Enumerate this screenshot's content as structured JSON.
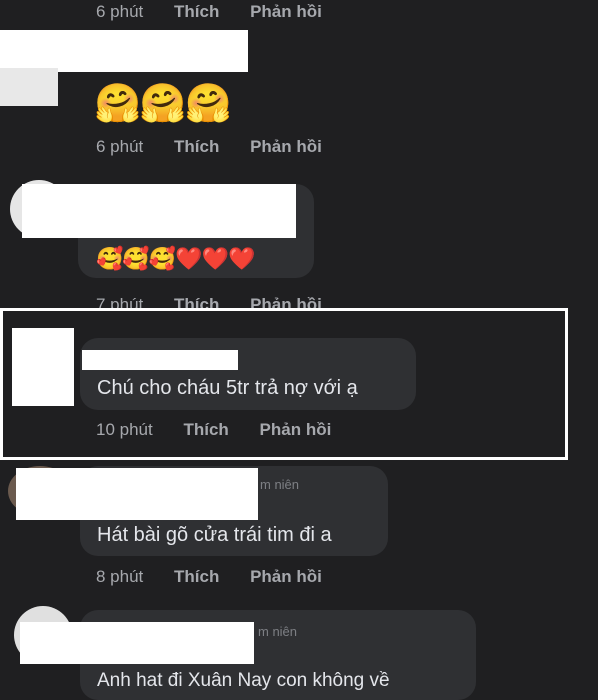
{
  "comments": [
    {
      "time": "6 phút",
      "like": "Thích",
      "reply": "Phản hồi"
    },
    {
      "emojis": "🤗🤗🤗",
      "time": "6 phút",
      "like": "Thích",
      "reply": "Phản hồi"
    },
    {
      "emojis": "🥰🥰🥰❤️❤️❤️",
      "time": "7 phút",
      "like": "Thích",
      "reply": "Phản hồi"
    },
    {
      "text": "Chú cho cháu 5tr trả nợ với ạ",
      "time": "10 phút",
      "like": "Thích",
      "reply": "Phản hồi"
    },
    {
      "badge": "m niên",
      "text": "Hát bài gõ cửa trái tim đi a",
      "time": "8 phút",
      "like": "Thích",
      "reply": "Phản hồi"
    },
    {
      "badge": "m niên",
      "text": "Anh hat đi Xuân Nay con không về"
    }
  ],
  "colors": {
    "background": "#1f1f21",
    "bubble": "#2f3033",
    "meta": "#a6a8ad",
    "highlight": "#ffffff"
  }
}
